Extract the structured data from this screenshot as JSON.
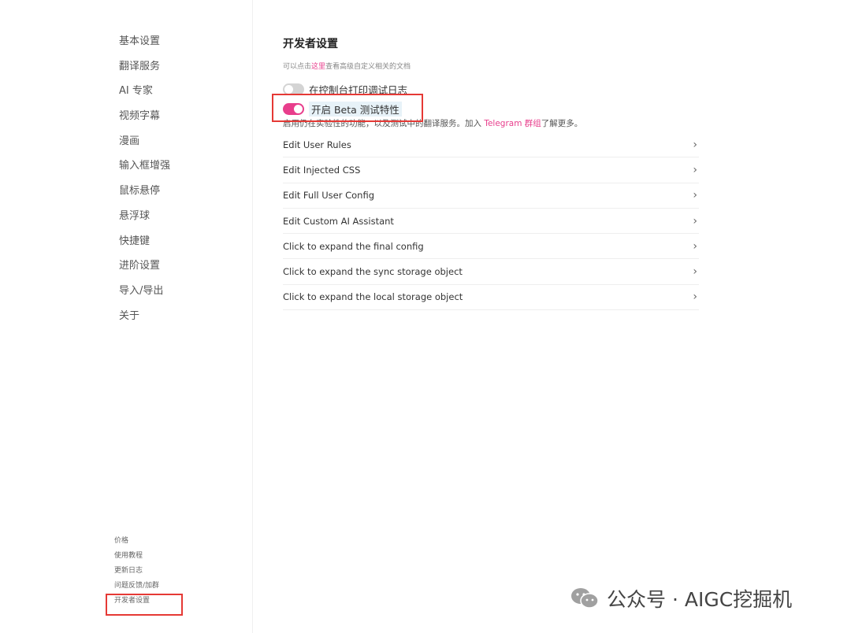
{
  "sidebar": {
    "nav": [
      "基本设置",
      "翻译服务",
      "AI 专家",
      "视频字幕",
      "漫画",
      "输入框增强",
      "鼠标悬停",
      "悬浮球",
      "快捷键",
      "进阶设置",
      "导入/导出",
      "关于"
    ],
    "footer": [
      "价格",
      "使用教程",
      "更新日志",
      "问题反馈/加群",
      "开发者设置"
    ]
  },
  "main": {
    "title": "开发者设置",
    "desc_prefix": "可以点击",
    "desc_link": "这里",
    "desc_suffix": "查看高级自定义相关的文档",
    "toggle_debug": {
      "label": "在控制台打印调试日志",
      "on": false
    },
    "toggle_beta": {
      "label": "开启 Beta 测试特性",
      "on": true
    },
    "beta_desc_prefix": "启用仍在实验性的功能，以及测试中的翻译服务。加入 ",
    "beta_desc_link": "Telegram 群组",
    "beta_desc_suffix": "了解更多。",
    "items": [
      "Edit User Rules",
      "Edit Injected CSS",
      "Edit Full User Config",
      "Edit Custom AI Assistant",
      "Click to expand the final config",
      "Click to expand the sync storage object",
      "Click to expand the local storage object"
    ]
  },
  "watermark": "公众号 · AIGC挖掘机",
  "colors": {
    "accent": "#e83e8c",
    "highlight": "#e53935"
  }
}
